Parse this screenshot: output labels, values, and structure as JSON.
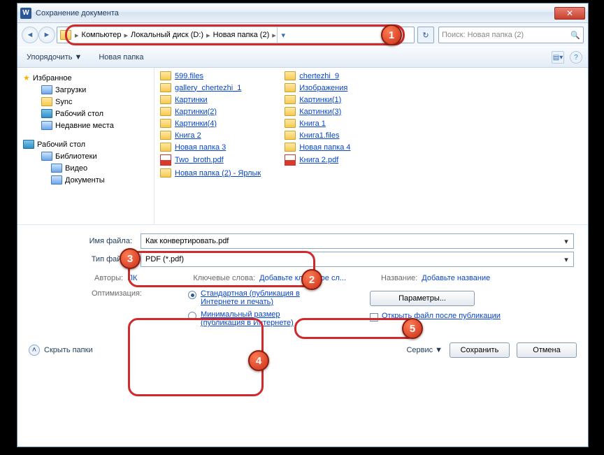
{
  "title": "Сохранение документа",
  "breadcrumb": [
    "Компьютер",
    "Локальный диск (D:)",
    "Новая папка (2)"
  ],
  "search_placeholder": "Поиск: Новая папка (2)",
  "toolbar": {
    "organize": "Упорядочить",
    "new_folder": "Новая папка"
  },
  "sidebar": {
    "favorites": "Избранное",
    "fav_items": [
      "Загрузки",
      "Sync",
      "Рабочий стол",
      "Недавние места"
    ],
    "desktop": "Рабочий стол",
    "libraries": "Библиотеки",
    "lib_items": [
      "Видео",
      "Документы"
    ]
  },
  "files_left": [
    {
      "t": "folder",
      "n": "599.files"
    },
    {
      "t": "folder",
      "n": "gallery_chertezhi_1"
    },
    {
      "t": "folder",
      "n": "Картинки"
    },
    {
      "t": "folder",
      "n": "Картинки(2)"
    },
    {
      "t": "folder",
      "n": "Картинки(4)"
    },
    {
      "t": "folder",
      "n": "Книга 2"
    },
    {
      "t": "folder",
      "n": "Новая папка 3"
    },
    {
      "t": "pdf",
      "n": "Two_broth.pdf"
    },
    {
      "t": "shortcut",
      "n": "Новая папка (2) - Ярлык"
    }
  ],
  "files_right": [
    {
      "t": "folder",
      "n": "chertezhi_9"
    },
    {
      "t": "folder",
      "n": "Изображения"
    },
    {
      "t": "folder",
      "n": "Картинки(1)"
    },
    {
      "t": "folder",
      "n": "Картинки(3)"
    },
    {
      "t": "folder",
      "n": "Книга 1"
    },
    {
      "t": "folder",
      "n": "Книга1.files"
    },
    {
      "t": "folder",
      "n": "Новая папка 4"
    },
    {
      "t": "pdf",
      "n": "Книга 2.pdf"
    }
  ],
  "form": {
    "filename_label": "Имя файла:",
    "filename_value": "Как конвертировать.pdf",
    "filetype_label": "Тип файла:",
    "filetype_value": "PDF (*.pdf)"
  },
  "meta": {
    "authors_label": "Авторы:",
    "authors_value": "ПК",
    "keywords_label": "Ключевые слова:",
    "keywords_value": "Добавьте ключевое сл...",
    "title_label": "Название:",
    "title_value": "Добавьте название"
  },
  "optimization": {
    "label": "Оптимизация:",
    "standard": "Стандартная (публикация в Интернете и печать)",
    "minimal": "Минимальный размер (публикация в Интернете)",
    "params_btn": "Параметры...",
    "open_after": "Открыть файл после публикации"
  },
  "footer": {
    "hide": "Скрыть папки",
    "service": "Сервис",
    "save": "Сохранить",
    "cancel": "Отмена"
  },
  "badges": {
    "1": "1",
    "2": "2",
    "3": "3",
    "4": "4",
    "5": "5"
  }
}
